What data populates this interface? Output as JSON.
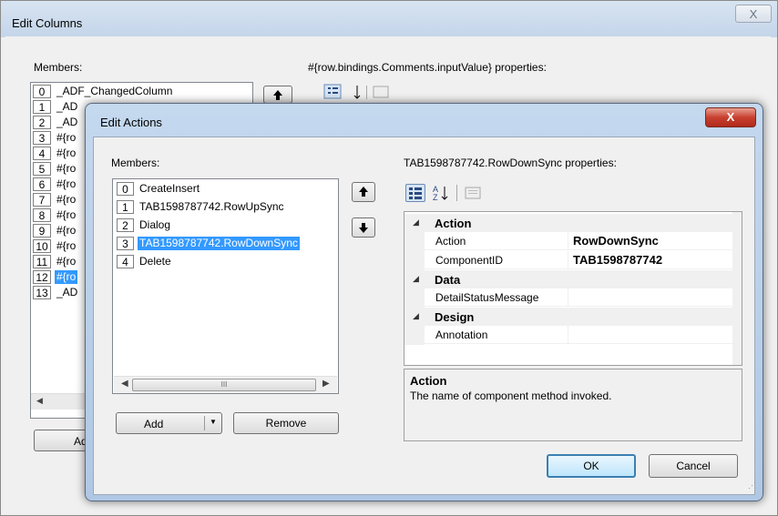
{
  "edit_columns": {
    "title": "Edit Columns",
    "close_glyph": "X",
    "members_label": "Members:",
    "properties_label": "#{row.bindings.Comments.inputValue} properties:",
    "add_label": "Ad",
    "members": [
      {
        "index": "0",
        "text": "_ADF_ChangedColumn"
      },
      {
        "index": "1",
        "text": "_AD"
      },
      {
        "index": "2",
        "text": "_AD"
      },
      {
        "index": "3",
        "text": "#{ro"
      },
      {
        "index": "4",
        "text": "#{ro"
      },
      {
        "index": "5",
        "text": "#{ro"
      },
      {
        "index": "6",
        "text": "#{ro"
      },
      {
        "index": "7",
        "text": "#{ro"
      },
      {
        "index": "8",
        "text": "#{ro"
      },
      {
        "index": "9",
        "text": "#{ro"
      },
      {
        "index": "10",
        "text": "#{ro"
      },
      {
        "index": "11",
        "text": "#{ro"
      },
      {
        "index": "12",
        "text": "#{ro",
        "selected": true
      },
      {
        "index": "13",
        "text": "_AD"
      }
    ]
  },
  "edit_actions": {
    "title": "Edit Actions",
    "close_glyph": "X",
    "members_label": "Members:",
    "members": [
      {
        "index": "0",
        "text": "CreateInsert"
      },
      {
        "index": "1",
        "text": "TAB1598787742.RowUpSync"
      },
      {
        "index": "2",
        "text": "Dialog"
      },
      {
        "index": "3",
        "text": "TAB1598787742.RowDownSync",
        "selected": true
      },
      {
        "index": "4",
        "text": "Delete"
      }
    ],
    "scroll_thumb_glyph": "III",
    "add_label": "Add",
    "remove_label": "Remove",
    "properties_label": "TAB1598787742.RowDownSync properties:",
    "sort_az_glyph": "A Z",
    "grid": {
      "categories": [
        {
          "name": "Action",
          "properties": [
            {
              "name": "Action",
              "value": "RowDownSync"
            },
            {
              "name": "ComponentID",
              "value": "TAB1598787742"
            }
          ]
        },
        {
          "name": "Data",
          "properties": [
            {
              "name": "DetailStatusMessage",
              "value": ""
            }
          ]
        },
        {
          "name": "Design",
          "properties": [
            {
              "name": "Annotation",
              "value": ""
            }
          ]
        }
      ]
    },
    "description": {
      "title": "Action",
      "text": "The name of component method invoked."
    },
    "ok_label": "OK",
    "cancel_label": "Cancel"
  },
  "colors": {
    "selection": "#3399ff",
    "title_gradient": "#c4d8ee",
    "close_red": "#c84030"
  }
}
